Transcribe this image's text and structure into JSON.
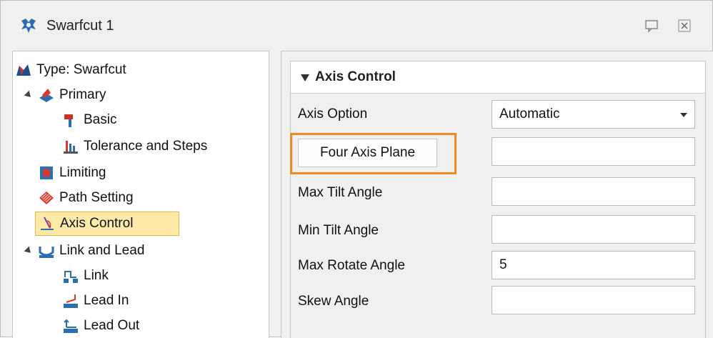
{
  "window": {
    "title": "Swarfcut 1",
    "icons": {
      "app": "swarfcut-app-icon",
      "chat": "comment-icon",
      "close": "close-icon"
    }
  },
  "tree": {
    "items": [
      {
        "label": "Type: Swarfcut",
        "icon": "swarfcut-type-icon"
      },
      {
        "label": "Primary",
        "icon": "primary-icon",
        "expanded": true
      },
      {
        "label": "Basic",
        "icon": "basic-icon"
      },
      {
        "label": "Tolerance and Steps",
        "icon": "tolerance-icon"
      },
      {
        "label": "Limiting",
        "icon": "limiting-icon"
      },
      {
        "label": "Path Setting",
        "icon": "path-setting-icon"
      },
      {
        "label": "Axis Control",
        "icon": "axis-control-icon",
        "selected": true
      },
      {
        "label": "Link and Lead",
        "icon": "link-lead-icon",
        "expanded": true
      },
      {
        "label": "Link",
        "icon": "link-icon"
      },
      {
        "label": "Lead In",
        "icon": "lead-in-icon"
      },
      {
        "label": "Lead Out",
        "icon": "lead-out-icon"
      }
    ]
  },
  "panel": {
    "group_title": "Axis Control",
    "axis_option": {
      "label": "Axis Option",
      "value": "Automatic"
    },
    "four_axis_plane": {
      "label": "Four Axis Plane",
      "value": ""
    },
    "max_tilt": {
      "label": "Max Tilt Angle",
      "value": ""
    },
    "min_tilt": {
      "label": "Min Tilt Angle",
      "value": ""
    },
    "max_rotate": {
      "label": "Max Rotate Angle",
      "value": "5"
    },
    "skew": {
      "label": "Skew Angle",
      "value": ""
    }
  },
  "colors": {
    "highlight": "#f08a24",
    "selection_bg": "#fde9a8",
    "selection_border": "#e3b64b"
  }
}
